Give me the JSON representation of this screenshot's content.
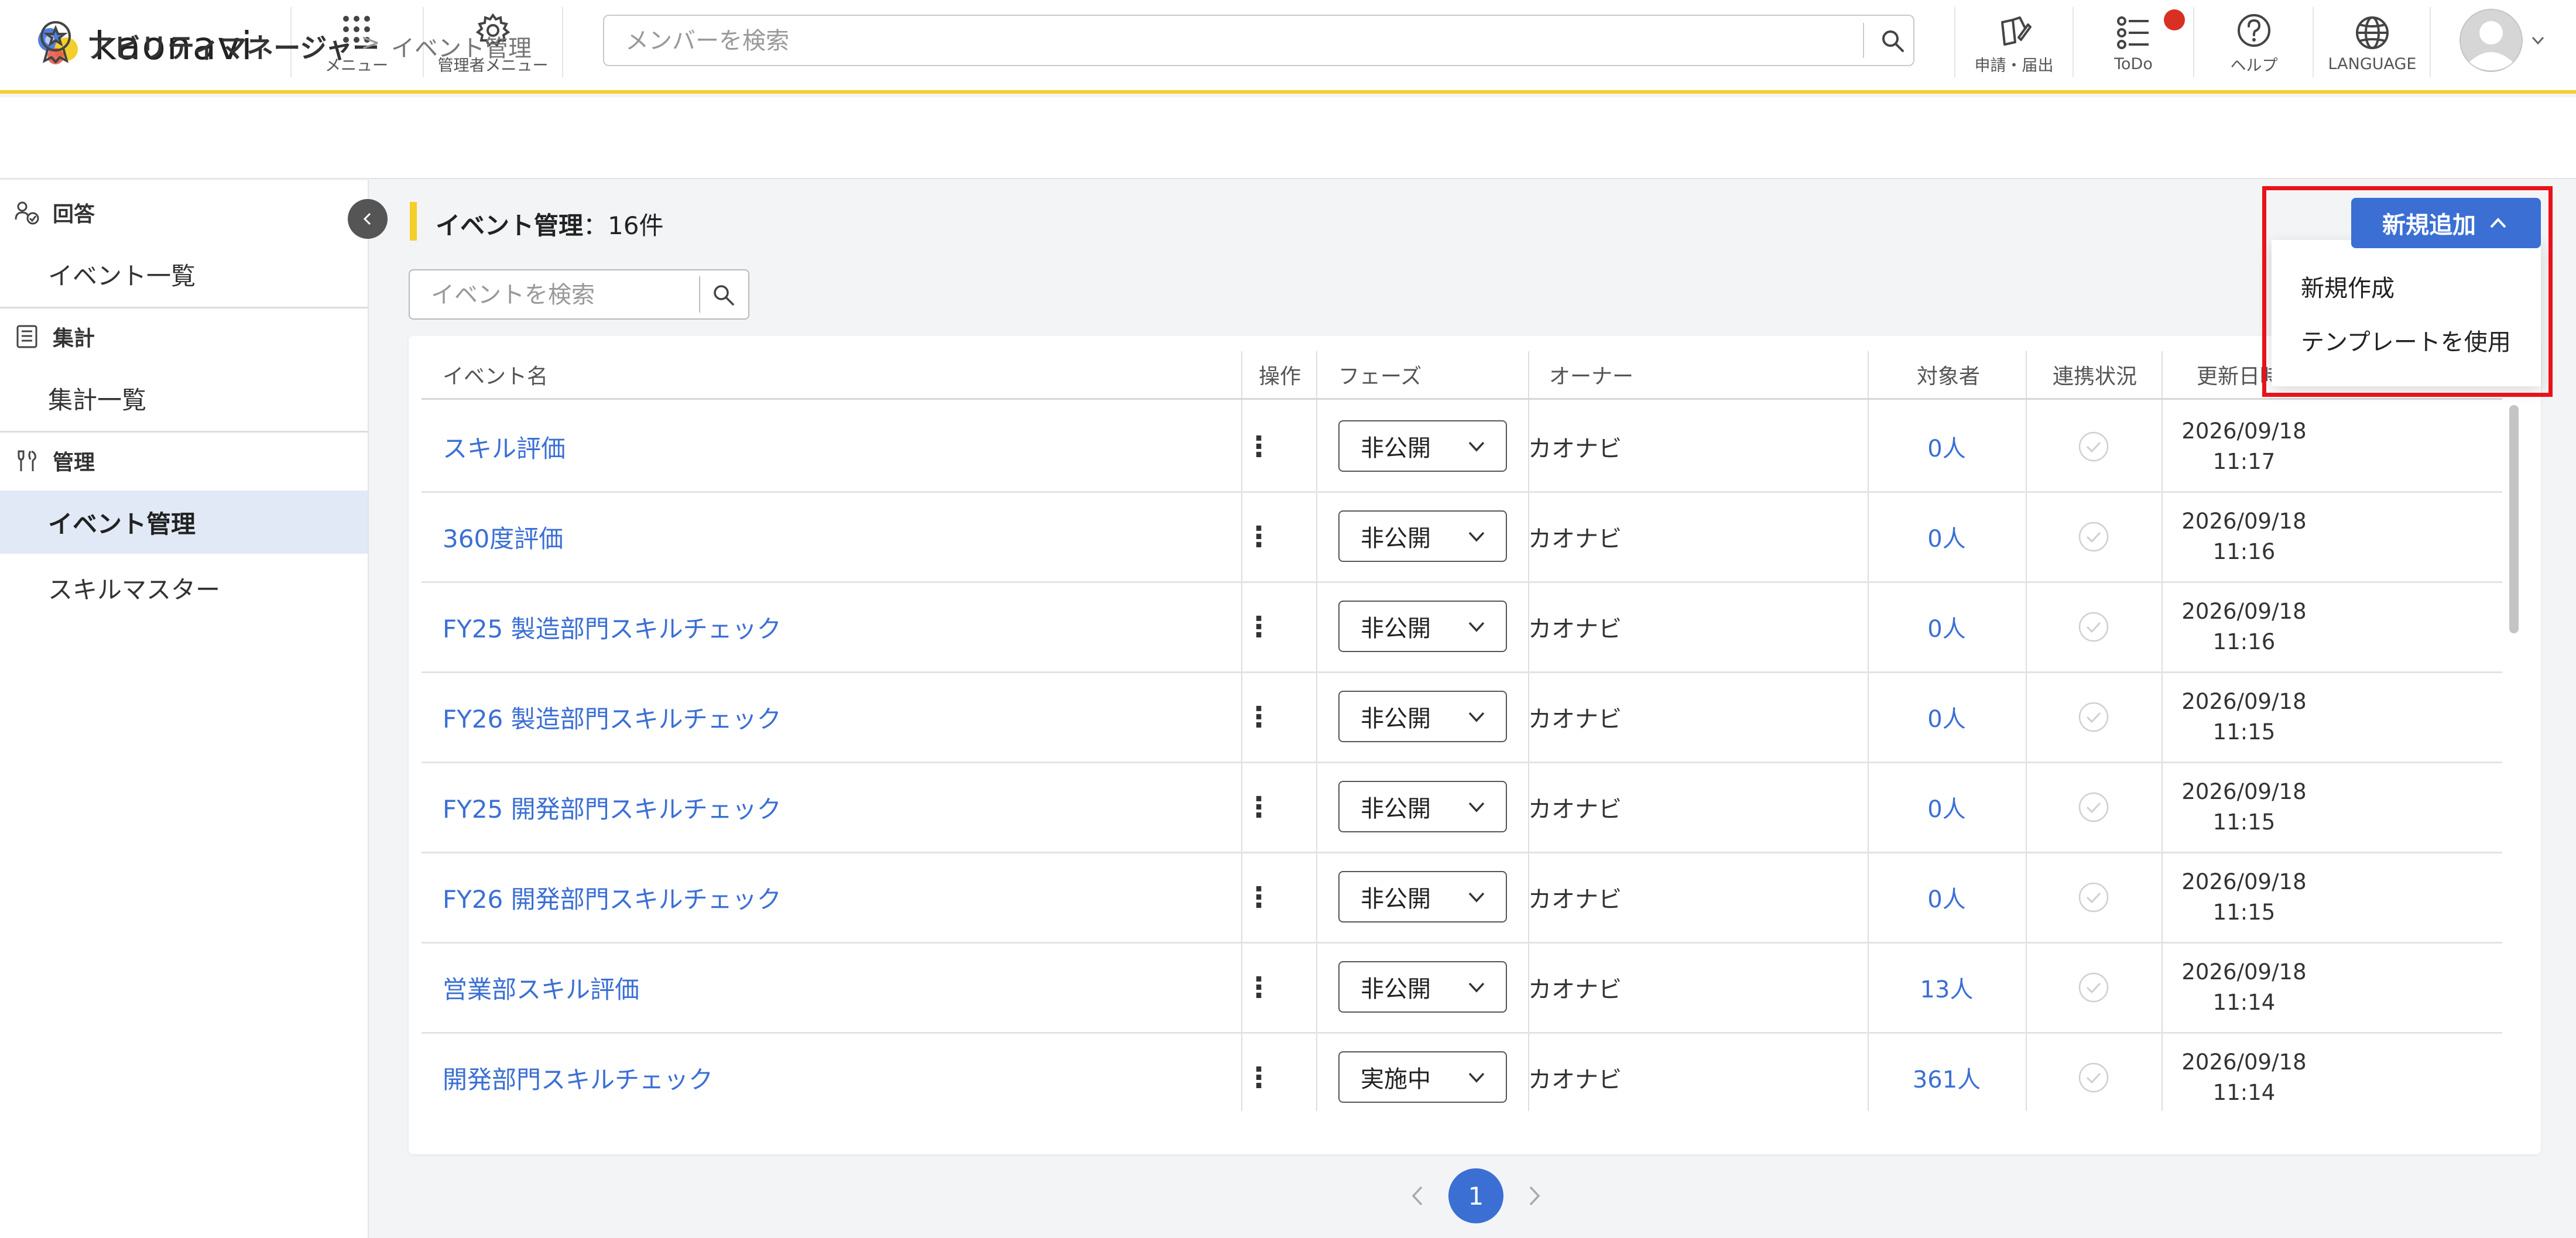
{
  "header": {
    "logo_text": "kaonavi",
    "menu_label": "メニュー",
    "admin_menu_label": "管理者メニュー",
    "search_placeholder": "メンバーを検索",
    "apply_label": "申請・届出",
    "todo_label": "ToDo",
    "help_label": "ヘルプ",
    "language_label": "LANGUAGE"
  },
  "breadcrumb": {
    "title": "アビリティマネージャー",
    "separator": ">",
    "current": "イベント管理"
  },
  "sidebar": {
    "sections": [
      {
        "heading": "回答",
        "items": [
          {
            "label": "イベント一覧"
          }
        ]
      },
      {
        "heading": "集計",
        "items": [
          {
            "label": "集計一覧"
          }
        ]
      },
      {
        "heading": "管理",
        "items": [
          {
            "label": "イベント管理",
            "active": true
          },
          {
            "label": "スキルマスター"
          }
        ]
      }
    ]
  },
  "main": {
    "title": "イベント管理",
    "count_text": "：16件",
    "add_button_label": "新規追加",
    "dropdown_items": [
      "新規作成",
      "テンプレートを使用"
    ],
    "event_search_placeholder": "イベントを検索",
    "table": {
      "headers": [
        "イベント名",
        "操作",
        "フェーズ",
        "オーナー",
        "対象者",
        "連携状況",
        "更新日時"
      ],
      "rows": [
        {
          "name": "スキル評価",
          "action": "⋮",
          "phase": "非公開",
          "owner": "カオナビ",
          "target": "0人",
          "date": "2026/09/18",
          "time": "11:17"
        },
        {
          "name": "360度評価",
          "action": "⋮",
          "phase": "非公開",
          "owner": "カオナビ",
          "target": "0人",
          "date": "2026/09/18",
          "time": "11:16"
        },
        {
          "name": "FY25 製造部門スキルチェック",
          "action": "⋮",
          "phase": "非公開",
          "owner": "カオナビ",
          "target": "0人",
          "date": "2026/09/18",
          "time": "11:16"
        },
        {
          "name": "FY26 製造部門スキルチェック",
          "action": "⋮",
          "phase": "非公開",
          "owner": "カオナビ",
          "target": "0人",
          "date": "2026/09/18",
          "time": "11:15"
        },
        {
          "name": "FY25 開発部門スキルチェック",
          "action": "⋮",
          "phase": "非公開",
          "owner": "カオナビ",
          "target": "0人",
          "date": "2026/09/18",
          "time": "11:15"
        },
        {
          "name": "FY26 開発部門スキルチェック",
          "action": "⋮",
          "phase": "非公開",
          "owner": "カオナビ",
          "target": "0人",
          "date": "2026/09/18",
          "time": "11:15"
        },
        {
          "name": "営業部スキル評価",
          "action": "⋮",
          "phase": "非公開",
          "owner": "カオナビ",
          "target": "13人",
          "date": "2026/09/18",
          "time": "11:14"
        },
        {
          "name": "開発部門スキルチェック",
          "action": "⋮",
          "phase": "実施中",
          "owner": "カオナビ",
          "target": "361人",
          "date": "2026/09/18",
          "time": "11:14"
        }
      ]
    },
    "pagination": {
      "current": "1"
    }
  },
  "colors": {
    "accent": "#3b6fd4",
    "header_border": "#f2cf2b",
    "highlight_frame": "#e8121b",
    "todo_badge": "#d93025",
    "active_sidebar": "#e1e9f6"
  }
}
